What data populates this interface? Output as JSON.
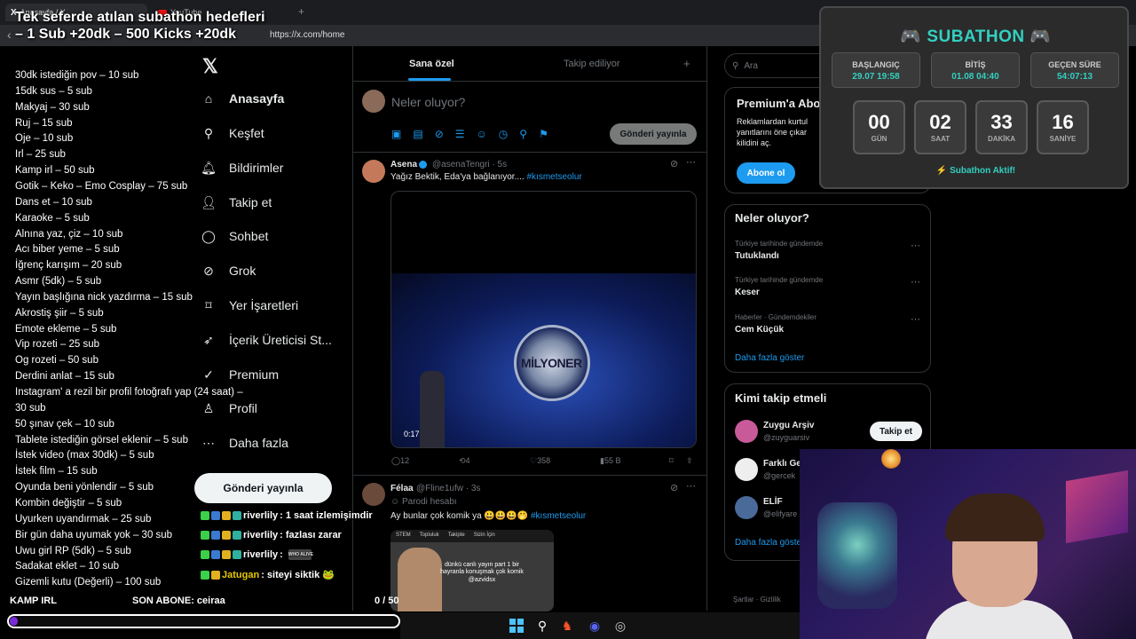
{
  "browser": {
    "tabs": [
      {
        "label": "Anasayfa / X"
      },
      {
        "label": "YouTube"
      }
    ],
    "url": "https://x.com/home"
  },
  "overlay": {
    "title": "Tek seferde atılan subathon hedefleri – 1 Sub +20dk – 500 Kicks +20dk",
    "items": [
      "30dk istediğin pov – 10 sub",
      "15dk sus – 5 sub",
      "Makyaj – 30 sub",
      "Ruj – 15 sub",
      "Oje – 10 sub",
      "Irl – 25 sub",
      "Kamp irl – 50 sub",
      "Gotik – Keko – Emo Cosplay – 75 sub",
      "Dans et – 10 sub",
      "Karaoke – 5 sub",
      "Alnına yaz, çiz – 10 sub",
      "Acı biber yeme – 5 sub",
      "İğrenç karışım – 20 sub",
      "Asmr (5dk) – 5 sub",
      "Yayın başlığına nick yazdırma – 15 sub",
      "Akrostiş şiir – 5 sub",
      "Emote ekleme – 5 sub",
      "Vip rozeti – 25 sub",
      "Og rozeti – 50 sub",
      "Derdini anlat – 15 sub",
      "Instagram' a rezil bir profil fotoğrafı yap (24 saat) –",
      "30 sub",
      "50 şınav çek – 10 sub",
      "Tablete istediğin görsel eklenir – 5 sub",
      "İstek video (max 30dk) – 5 sub",
      "İstek film – 15 sub",
      "Oyunda beni yönlendir – 5 sub",
      "Kombin değiştir – 5 sub",
      "Uyurken uyandırmak – 25 sub",
      "Bir gün daha uyumak yok – 30 sub",
      "Uwu girl RP (5dk) – 5 sub",
      "Sadakat eklet – 10 sub",
      "Gizemli kutu (Değerli) – 100 sub"
    ]
  },
  "x": {
    "logo": "𝕏",
    "nav": [
      {
        "label": "Anasayfa",
        "icon": "home-icon",
        "glyph": "⌂"
      },
      {
        "label": "Keşfet",
        "icon": "search-icon",
        "glyph": "⚲"
      },
      {
        "label": "Bildirimler",
        "icon": "bell-icon",
        "glyph": "🔔︎"
      },
      {
        "label": "Takip et",
        "icon": "follow-icon",
        "glyph": "👤︎"
      },
      {
        "label": "Sohbet",
        "icon": "chat-icon",
        "glyph": "◯"
      },
      {
        "label": "Grok",
        "icon": "grok-icon",
        "glyph": "⊘"
      },
      {
        "label": "Yer İşaretleri",
        "icon": "bookmark-icon",
        "glyph": "⌑"
      },
      {
        "label": "İçerik Üreticisi St...",
        "icon": "rocket-icon",
        "glyph": "➶"
      },
      {
        "label": "Premium",
        "icon": "premium-icon",
        "glyph": "✓"
      },
      {
        "label": "Profil",
        "icon": "profile-icon",
        "glyph": "♙"
      },
      {
        "label": "Daha fazla",
        "icon": "more-icon",
        "glyph": "⋯"
      }
    ],
    "post_button": "Gönderi yayınla",
    "tabs": {
      "for_you": "Sana özel",
      "following": "Takip ediliyor",
      "plus": "+"
    },
    "compose": {
      "placeholder": "Neler oluyor?",
      "post": "Gönderi yayınla"
    },
    "tweet1": {
      "name": "Asena",
      "handle": "@asenaTengri · 5s",
      "text": "Yağız Bektik, Eda'ya bağlanıyor.... ",
      "hashtag": "#kısmetseolur",
      "video_time": "0:17",
      "video_logo": "MİLYONER",
      "replies": "12",
      "retweets": "4",
      "likes": "358",
      "views": "55 B"
    },
    "tweet2": {
      "name": "Félaa",
      "handle": "@Fline1ufw · 3s",
      "label": "Parodi hesabı",
      "text": "Ay bunlar çok komik ya 😃😃😃🤭 ",
      "hashtag": "#kısmetseolur",
      "thumb_tabs": [
        "STEM",
        "Topluluk",
        "Takipte",
        "Sizin İçin"
      ],
      "thumb_caption": "dünkü canlı yayın part 1 bir hayranla konuşmak çok komik @azvidsx"
    },
    "search_placeholder": "Ara",
    "premium": {
      "title": "Premium'a Abo",
      "text": "Reklamlardan kurtul yanıtlarını öne çıkar kilidini aç.",
      "button": "Abone ol"
    },
    "trends": {
      "title": "Neler oluyor?",
      "items": [
        {
          "meta": "Türkiye tarihinde gündemde",
          "name": "Tutuklandı"
        },
        {
          "meta": "Türkiye tarihinde gündemde",
          "name": "Keser"
        },
        {
          "meta": "Haberler · Gündemdekiler",
          "name": "Cem Küçük"
        }
      ],
      "more": "Daha fazla göster"
    },
    "who_to_follow": {
      "title": "Kimi takip etmeli",
      "items": [
        {
          "name": "Zuygu Arşiv",
          "handle": "@zuyguarsiv"
        },
        {
          "name": "Farklı Ge",
          "handle": "@gercek"
        },
        {
          "name": "ELİF",
          "handle": "@elifyare"
        }
      ],
      "follow": "Takip et",
      "more": "Daha fazla göster"
    },
    "footer": "Şartlar · Gizlilik"
  },
  "chat": [
    {
      "user": "riverlily",
      "msg": ": 1 saat izlemişimdir"
    },
    {
      "user": "riverlily",
      "msg": ": fazlası zarar"
    },
    {
      "user": "riverlily",
      "msg": ":",
      "badge": "WHO ALIVE"
    },
    {
      "user": "Jatugan",
      "msg": ": siteyi siktik 🐸"
    }
  ],
  "bottom": {
    "left": "KAMP IRL",
    "last_sub": "SON ABONE: ceiraa",
    "progress": "0 / 50",
    "progress_value": 0.02
  },
  "subathon": {
    "title": "🎮 SUBATHON 🎮",
    "start_label": "BAŞLANGIÇ",
    "start_value": "29.07 19:58",
    "end_label": "BİTİŞ",
    "end_value": "01.08 04:40",
    "elapsed_label": "GEÇEN SÜRE",
    "elapsed_value": "54:07:13",
    "countdown": [
      {
        "num": "00",
        "unit": "GÜN"
      },
      {
        "num": "02",
        "unit": "SAAT"
      },
      {
        "num": "33",
        "unit": "DAKİKA"
      },
      {
        "num": "16",
        "unit": "SANİYE"
      }
    ],
    "status_icon": "⚡",
    "status": "Subathon Aktif!"
  },
  "colors": {
    "accent": "#1d9bf0",
    "subathon": "#33d0c0",
    "progress": "#7a2ad8"
  }
}
